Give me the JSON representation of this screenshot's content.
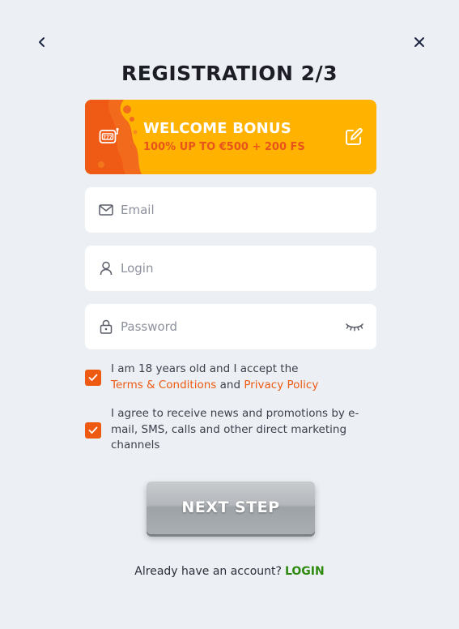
{
  "header": {
    "back_icon": "chevron-left-icon",
    "close_icon": "close-icon",
    "title": "REGISTRATION 2/3"
  },
  "bonus": {
    "icon": "slot-machine-icon",
    "title": "WELCOME BONUS",
    "subtitle": "100% UP TO €500 + 200 FS",
    "edit_icon": "edit-icon",
    "colors": {
      "background": "#ffb300",
      "flame": "#f26a1b",
      "subtitle": "#e8541c"
    }
  },
  "form": {
    "email": {
      "placeholder": "Email",
      "value": "",
      "icon": "mail-icon"
    },
    "login": {
      "placeholder": "Login",
      "value": "",
      "icon": "user-icon"
    },
    "password": {
      "placeholder": "Password",
      "value": "",
      "icon": "lock-icon",
      "toggle_icon": "eye-closed-icon"
    }
  },
  "consent": {
    "age": {
      "checked": true,
      "text_before": "I am 18 years old and I accept the",
      "terms_link": "Terms & Conditions",
      "conjunction": "and",
      "privacy_link": "Privacy Policy"
    },
    "marketing": {
      "checked": true,
      "text": "I agree to receive news and promotions by e-mail, SMS, calls and other direct marketing channels"
    }
  },
  "actions": {
    "next_label": "NEXT STEP"
  },
  "footer": {
    "prompt": "Already have an account?",
    "login_link": "LOGIN",
    "login_color": "#2e8a0f"
  },
  "theme": {
    "accent": "#ef5a12",
    "background": "#eceff4"
  }
}
